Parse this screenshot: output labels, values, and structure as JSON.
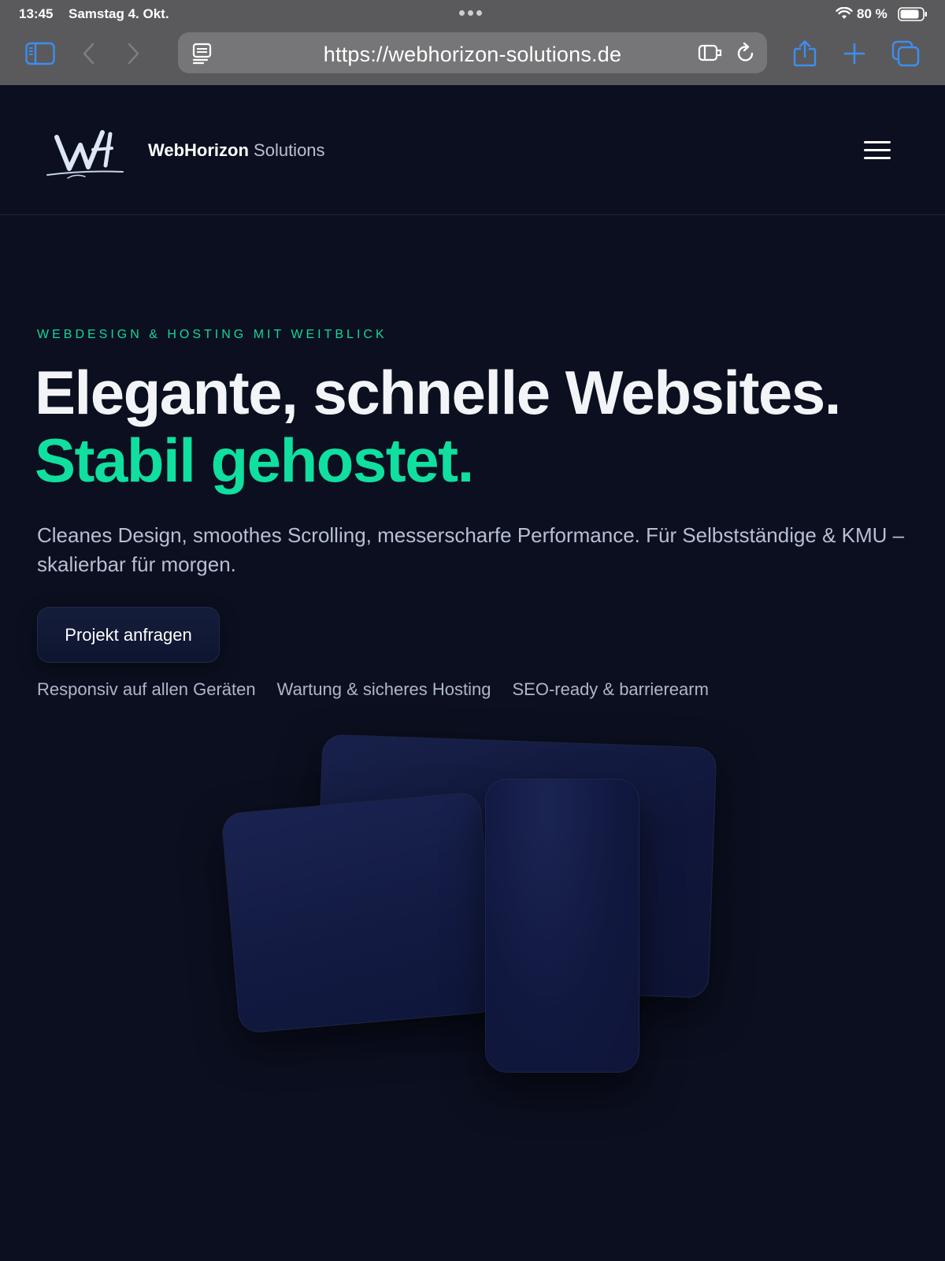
{
  "status_bar": {
    "time": "13:45",
    "date": "Samstag 4. Okt.",
    "battery": "80 %"
  },
  "browser": {
    "url": "https://webhorizon-solutions.de",
    "icons": [
      "sidebar-icon",
      "back-icon",
      "forward-icon",
      "reader-icon",
      "extension-icon",
      "reload-icon",
      "share-icon",
      "new-tab-icon",
      "tabs-icon"
    ]
  },
  "header": {
    "logo_text": "WH",
    "brand_strong": "WebHorizon",
    "brand_light": " Solutions"
  },
  "hero": {
    "eyebrow": "WEBDESIGN & HOSTING MIT WEITBLICK",
    "headline_1": "Elegante, schnelle Websites.",
    "headline_2": "Stabil gehostet.",
    "subline": "Cleanes Design, smoothes Scrolling, messerscharfe Performance. Für Selbstständige & KMU – skalierbar für morgen.",
    "cta": "Projekt anfragen",
    "features": [
      "Responsiv auf allen Geräten",
      "Wartung & sicheres Hosting",
      "SEO-ready & barrierearm"
    ]
  },
  "colors": {
    "background": "#0b0f1f",
    "accent": "#10df9f",
    "browser_chrome": "#5a5a5c",
    "safari_blue": "#3d8ef0"
  }
}
